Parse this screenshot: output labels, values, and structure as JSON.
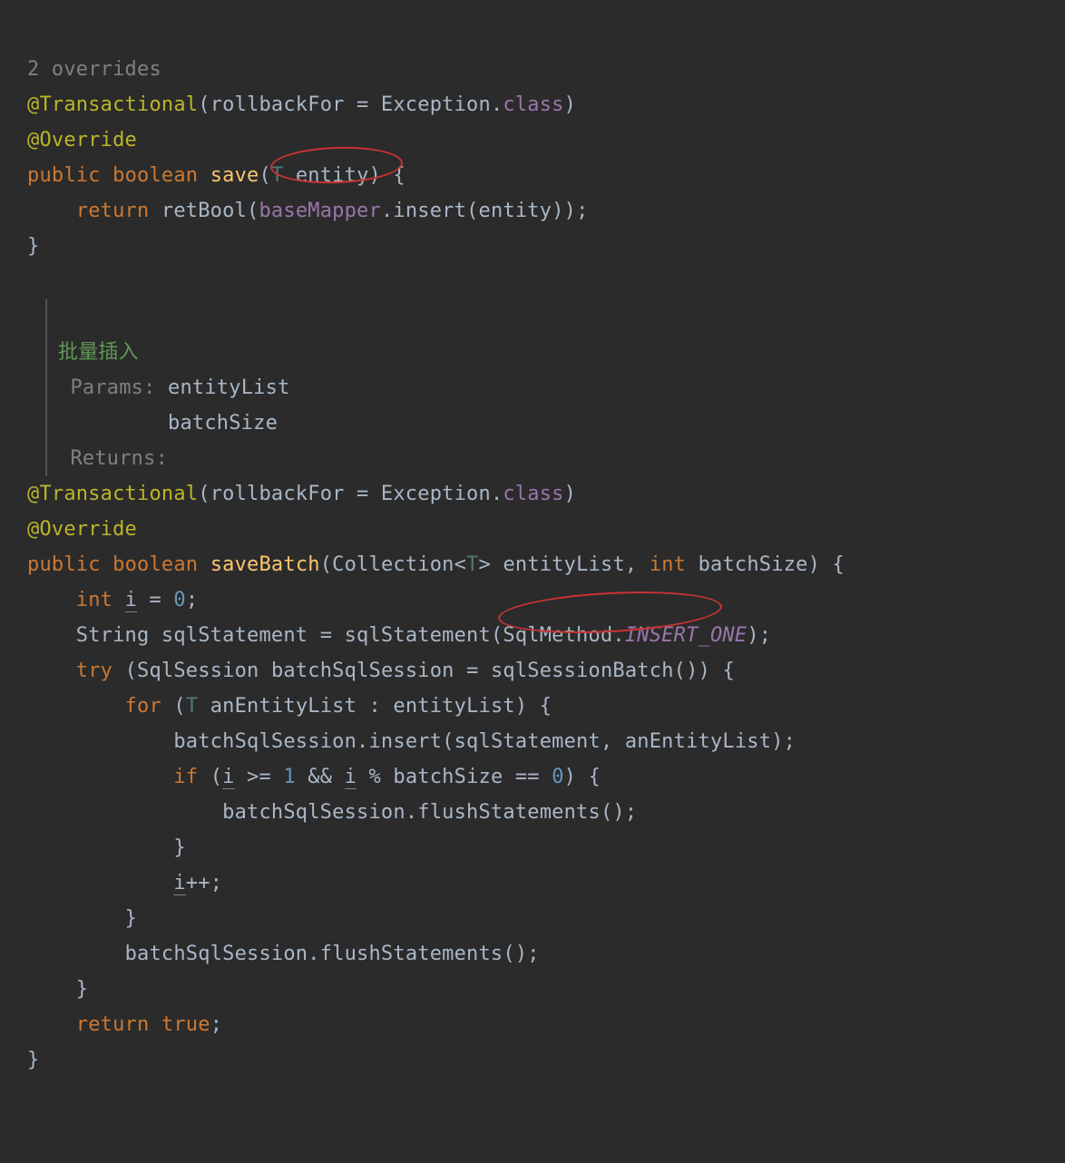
{
  "hint_overrides": "2 overrides",
  "anno_transactional": "@Transactional",
  "anno_override": "@Override",
  "anno_args_open": "(",
  "anno_param_rollback": "rollbackFor = Exception",
  "anno_dot": ".",
  "anno_class": "class",
  "anno_args_close": ")",
  "kw_public": "public",
  "kw_boolean": "boolean",
  "kw_return": "return",
  "kw_int": "int",
  "kw_try": "try",
  "kw_for": "for",
  "kw_if": "if",
  "kw_true": "true",
  "m_save": "save",
  "m_saveBatch": "saveBatch",
  "m_retBool": "retBool",
  "m_insert": "insert",
  "m_sqlStatement": "sqlStatement",
  "m_sqlSessionBatch": "sqlSessionBatch",
  "m_flushStatements": "flushStatements",
  "fld_baseMapper": "baseMapper",
  "fld_INSERT_ONE": "INSERT_ONE",
  "type_T": "T",
  "type_Collection": "Collection",
  "type_String": "String",
  "type_SqlSession": "SqlSession",
  "type_SqlMethod": "SqlMethod",
  "param_entity": "entity",
  "param_entityList": "entityList",
  "param_batchSize": "batchSize",
  "local_i": "i",
  "local_sqlStatement": "sqlStatement",
  "local_batchSqlSession": "batchSqlSession",
  "local_anEntityList": "anEntityList",
  "num_0": "0",
  "num_1": "1",
  "doc_title": "批量插入",
  "doc_params_label": "Params:",
  "doc_param1": "entityList",
  "doc_param2": "batchSize",
  "doc_returns_label": "Returns:",
  "sym_lbrace": "{",
  "sym_rbrace": "}",
  "sym_lparen": "(",
  "sym_rparen": ")",
  "sym_semi": ";",
  "sym_dot": ".",
  "sym_comma": ", ",
  "sym_lt": "<",
  "sym_gt": ">",
  "sym_colon": " : ",
  "sym_eq": " = ",
  "sym_ge": " >= ",
  "sym_mod": " % ",
  "sym_eqeq": " == ",
  "sym_andand": " && ",
  "sym_pp": "++"
}
